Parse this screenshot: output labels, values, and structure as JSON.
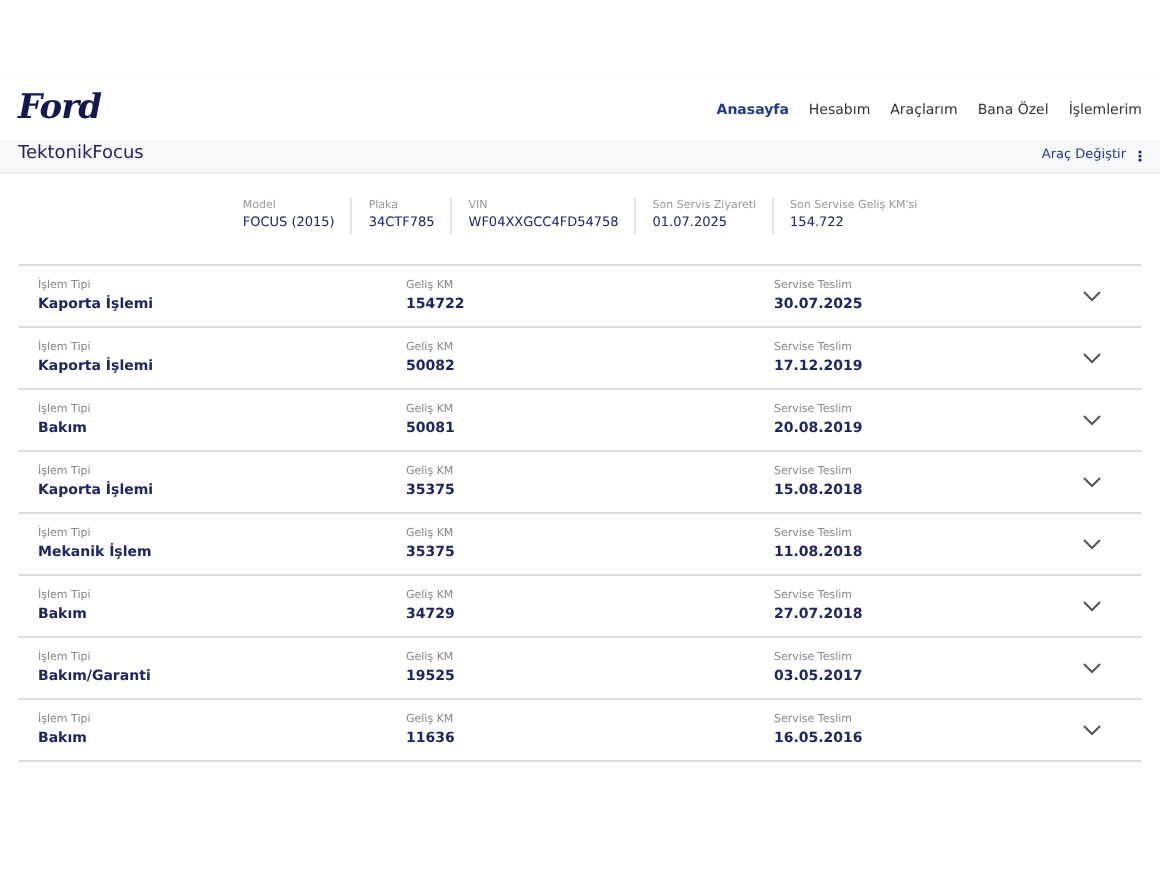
{
  "header": {
    "logo": "Ford",
    "nav": [
      {
        "label": "Anasayfa",
        "selected": true
      },
      {
        "label": "Hesabım",
        "selected": false
      },
      {
        "label": "Araçlarım",
        "selected": false
      },
      {
        "label": "Bana Özel",
        "selected": false
      },
      {
        "label": "İşlemlerim",
        "selected": false
      }
    ]
  },
  "title_bar": {
    "title": "TektonikFocus",
    "action": "Araç Değiştir"
  },
  "vehicle_info": [
    {
      "label": "Model",
      "value": "FOCUS (2015)"
    },
    {
      "label": "Plaka",
      "value": "34CTF785"
    },
    {
      "label": "VIN",
      "value": "WF04XXGCC4FD54758"
    },
    {
      "label": "Son Servis Ziyareti",
      "value": "01.07.2025"
    },
    {
      "label": "Son Servise Geliş KM'si",
      "value": "154.722"
    }
  ],
  "records": [
    {
      "type_label": "İşlem Tipi",
      "type": "Kaporta İşlemi",
      "km_label": "Geliş KM",
      "km": "154722",
      "date_label": "Servise Teslim",
      "date": "30.07.2025"
    },
    {
      "type_label": "İşlem Tipi",
      "type": "Kaporta İşlemi",
      "km_label": "Geliş KM",
      "km": "50082",
      "date_label": "Servise Teslim",
      "date": "17.12.2019"
    },
    {
      "type_label": "İşlem Tipi",
      "type": "Bakım",
      "km_label": "Geliş KM",
      "km": "50081",
      "date_label": "Servise Teslim",
      "date": "20.08.2019"
    },
    {
      "type_label": "İşlem Tipi",
      "type": "Kaporta İşlemi",
      "km_label": "Geliş KM",
      "km": "35375",
      "date_label": "Servise Teslim",
      "date": "15.08.2018"
    },
    {
      "type_label": "İşlem Tipi",
      "type": "Mekanik İşlem",
      "km_label": "Geliş KM",
      "km": "35375",
      "date_label": "Servise Teslim",
      "date": "11.08.2018"
    },
    {
      "type_label": "İşlem Tipi",
      "type": "Bakım",
      "km_label": "Geliş KM",
      "km": "34729",
      "date_label": "Servise Teslim",
      "date": "27.07.2018"
    },
    {
      "type_label": "İşlem Tipi",
      "type": "Bakım/Garanti",
      "km_label": "Geliş KM",
      "km": "19525",
      "date_label": "Servise Teslim",
      "date": "03.05.2017"
    },
    {
      "type_label": "İşlem Tipi",
      "type": "Bakım",
      "km_label": "Geliş KM",
      "km": "11636",
      "date_label": "Servise Teslim",
      "date": "16.05.2016"
    }
  ]
}
